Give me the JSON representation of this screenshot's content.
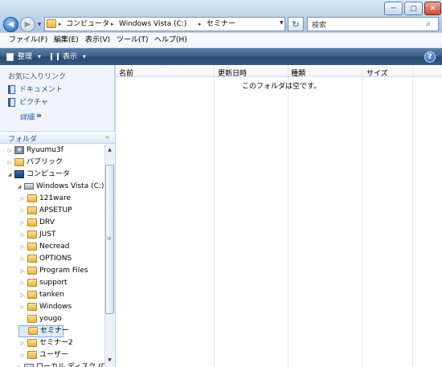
{
  "window": {
    "controls": {
      "minimize": "─",
      "maximize": "□",
      "close": "✕"
    }
  },
  "navigation": {
    "back": "◀",
    "forward": "▶",
    "history": "▼"
  },
  "address_bar": {
    "crumbs": [
      "コンピュータ",
      "Windows Vista (C:)",
      "セミナー"
    ],
    "separator": "▸",
    "dropdown": "▼",
    "refresh": "↻"
  },
  "search": {
    "placeholder": "検索",
    "icon": "⌕"
  },
  "menu": [
    "ファイル(F)",
    "編集(E)",
    "表示(V)",
    "ツール(T)",
    "ヘルプ(H)"
  ],
  "toolbar": {
    "organize": "整理",
    "views": "表示",
    "dropdown": "▾",
    "help": "?"
  },
  "favorites": {
    "header": "お気に入りリンク",
    "items": [
      "ドキュメント",
      "ピクチャ"
    ],
    "details": "詳細",
    "details_chevron": "»"
  },
  "folders": {
    "header": "フォルダ",
    "collapse": "⌄",
    "tree": [
      {
        "label": "Ryuumu3f",
        "expander": "▷",
        "icon": "user-icon"
      },
      {
        "label": "パブリック",
        "expander": "▷",
        "icon": "folder-icon"
      },
      {
        "label": "コンピュータ",
        "expander": "◢",
        "icon": "computer-icon"
      },
      {
        "label": "Windows Vista (C:)",
        "expander": "◢",
        "icon": "drive-icon"
      },
      {
        "label": "121ware",
        "expander": "▷",
        "icon": "folder-icon"
      },
      {
        "label": "APSETUP",
        "expander": "▷",
        "icon": "folder-icon"
      },
      {
        "label": "DRV",
        "expander": "▷",
        "icon": "folder-icon"
      },
      {
        "label": "JUST",
        "expander": "▷",
        "icon": "folder-icon"
      },
      {
        "label": "Necread",
        "expander": "▷",
        "icon": "folder-icon"
      },
      {
        "label": "OPTIONS",
        "expander": "▷",
        "icon": "folder-icon"
      },
      {
        "label": "Program Files",
        "expander": "▷",
        "icon": "folder-icon"
      },
      {
        "label": "support",
        "expander": "▷",
        "icon": "folder-icon"
      },
      {
        "label": "tanken",
        "expander": "▷",
        "icon": "folder-icon"
      },
      {
        "label": "Windows",
        "expander": "▷",
        "icon": "folder-icon"
      },
      {
        "label": "yougo",
        "expander": "",
        "icon": "folder-icon"
      },
      {
        "label": "セミナー",
        "expander": "",
        "icon": "folder-icon",
        "selected": true
      },
      {
        "label": "セミナー2",
        "expander": "▷",
        "icon": "folder-icon"
      },
      {
        "label": "ユーザー",
        "expander": "▷",
        "icon": "folder-icon"
      },
      {
        "label": "ローカル ディスク (D:)",
        "expander": "▷",
        "icon": "drive-icon"
      }
    ],
    "scroll": {
      "up": "▲",
      "down": "▼",
      "grip": "≡"
    }
  },
  "columns": {
    "headers": [
      "名前",
      "更新日時",
      "種類",
      "サイズ"
    ],
    "sort_indicator": "^"
  },
  "content": {
    "empty_message": "このフォルダは空です。"
  }
}
